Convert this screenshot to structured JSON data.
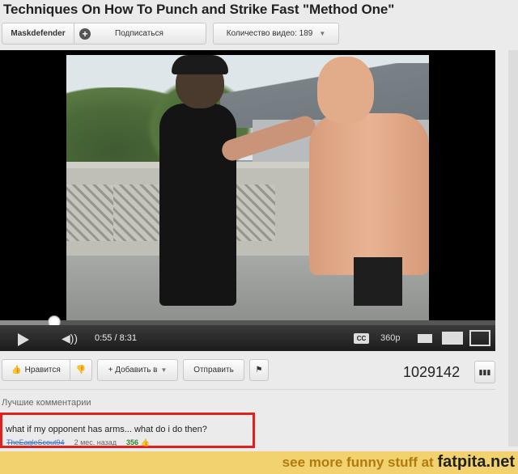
{
  "page": {
    "title": "Techniques On How To Punch and Strike Fast \"Method One\""
  },
  "channel_bar": {
    "channel_name": "Maskdefender",
    "subscribe_label": "Подписаться",
    "videos_label": "Количество видео: 189"
  },
  "player": {
    "current_time": "0:55",
    "duration": "8:31",
    "time_display": "0:55 / 8:31",
    "cc_label": "CC",
    "quality_label": "360p",
    "progress_fraction": 0.11
  },
  "actions": {
    "like_label": "Нравится",
    "add_label": "Добавить в",
    "share_label": "Отправить",
    "view_count": "1029142"
  },
  "comments": {
    "section_label": "Лучшие комментарии",
    "top": {
      "text": "what if my opponent has arms... what do i do then?",
      "author": "TheEagleScout94",
      "time": "2 мес. назад",
      "likes": "356"
    }
  },
  "footer_banner": {
    "lead": "see more funny stuff at",
    "site": "fatpita.net"
  },
  "colors": {
    "highlight_border": "#e0201c",
    "banner_bg": "#f1d26e",
    "banner_text": "#b07a10"
  }
}
